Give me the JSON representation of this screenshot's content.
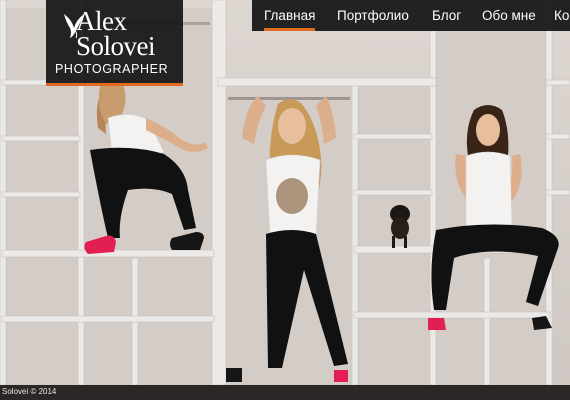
{
  "logo": {
    "name_line1": "Alex",
    "name_line2": "Solovei",
    "subtitle": "PHOTOGRAPHER",
    "icon": "bird-icon"
  },
  "nav": {
    "items": [
      {
        "label": "Главная",
        "active": true
      },
      {
        "label": "Портфолио",
        "active": false
      },
      {
        "label": "Блог",
        "active": false
      },
      {
        "label": "Обо мне",
        "active": false
      },
      {
        "label": "Ко",
        "active": false
      }
    ]
  },
  "hero": {
    "image": "photo-three-models-in-white-shelving"
  },
  "footer": {
    "copyright": "Solovei © 2014"
  },
  "colors": {
    "accent": "#e06a20",
    "shelf": "#eae7e4",
    "background_dark": "#2a2726"
  }
}
